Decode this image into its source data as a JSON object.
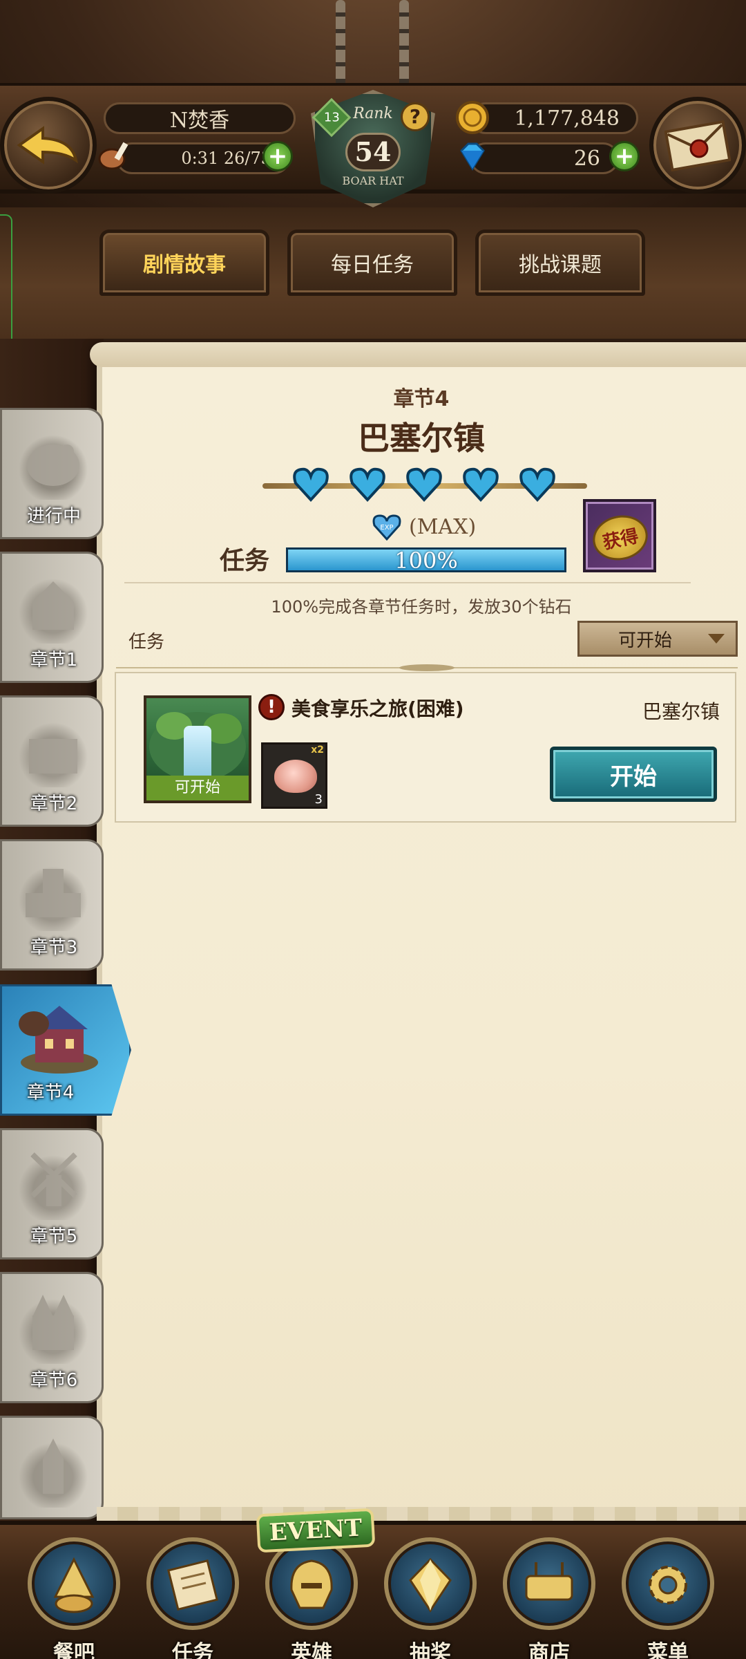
{
  "header": {
    "player_name": "N焚香",
    "stamina": "0:31 26/73",
    "rank_label": "Rank",
    "rank_value": "54",
    "level_badge": "13",
    "gold": "1,177,848",
    "diamonds": "26",
    "emblem_text": "BOAR HAT"
  },
  "tabs": [
    {
      "label": "剧情故事",
      "active": true
    },
    {
      "label": "每日任务",
      "active": false
    },
    {
      "label": "挑战课题",
      "active": false
    }
  ],
  "chapters": [
    {
      "label": "进行中"
    },
    {
      "label": "章节1"
    },
    {
      "label": "章节2"
    },
    {
      "label": "章节3"
    },
    {
      "label": "章节4",
      "active": true
    },
    {
      "label": "章节5"
    },
    {
      "label": "章节6"
    },
    {
      "label": ""
    }
  ],
  "panel": {
    "chapter_number": "章节4",
    "chapter_title": "巴塞尔镇",
    "hearts_count": 5,
    "exp_badge": "EXP",
    "max_label": "(MAX)",
    "task_label": "任务",
    "progress_text": "100%",
    "progress_fraction": 1.0,
    "reward_stamp": "获得",
    "completion_note": "100%完成各章节任务时，发放30个钻石",
    "list_label": "任务",
    "filter_value": "可开始"
  },
  "quests": [
    {
      "name": "美食享乐之旅(困难)",
      "location": "巴塞尔镇",
      "status": "可开始",
      "item_multiplier": "x2",
      "item_qty": "3",
      "start_label": "开始"
    }
  ],
  "bottom_nav": {
    "event_banner": "EVENT",
    "items": [
      {
        "label": "餐吧",
        "icon": "tavern-icon"
      },
      {
        "label": "任务",
        "icon": "scroll-icon"
      },
      {
        "label": "英雄",
        "icon": "helmet-icon"
      },
      {
        "label": "抽奖",
        "icon": "crystal-icon"
      },
      {
        "label": "商店",
        "icon": "shop-icon"
      },
      {
        "label": "菜单",
        "icon": "gear-icon"
      }
    ]
  },
  "colors": {
    "accent_gold": "#ffd45a",
    "progress_blue": "#2b96cf",
    "start_teal": "#186a78",
    "parchment": "#f6eed8"
  }
}
